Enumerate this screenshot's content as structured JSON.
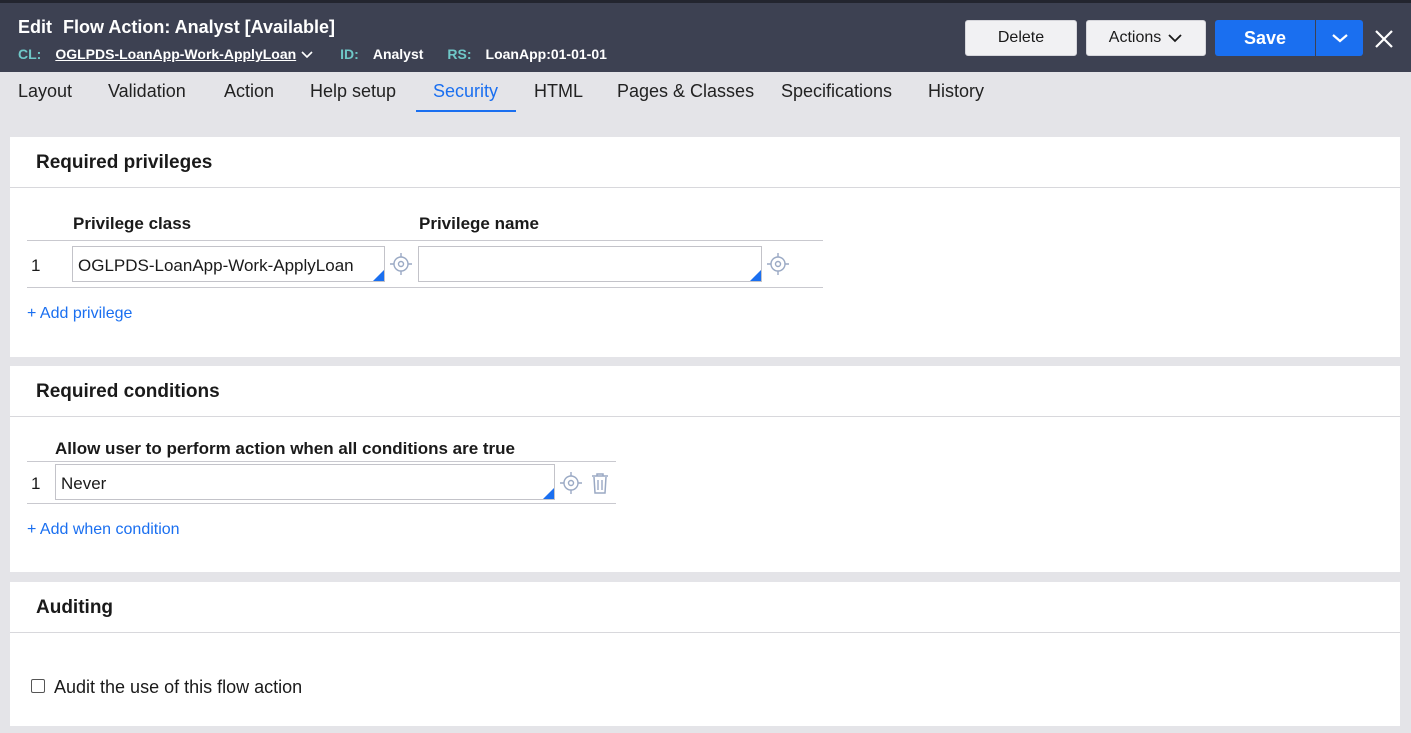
{
  "header": {
    "edit_label": "Edit",
    "title": "Flow Action: Analyst [Available]",
    "cl_key": "CL:",
    "cl_value": "OGLPDS-LoanApp-Work-ApplyLoan",
    "id_key": "ID:",
    "id_value": "Analyst",
    "rs_key": "RS:",
    "rs_value": "LoanApp:01-01-01",
    "delete_label": "Delete",
    "actions_label": "Actions",
    "save_label": "Save"
  },
  "tabs": [
    {
      "label": "Layout"
    },
    {
      "label": "Validation"
    },
    {
      "label": "Action"
    },
    {
      "label": "Help setup"
    },
    {
      "label": "Security"
    },
    {
      "label": "HTML"
    },
    {
      "label": "Pages & Classes"
    },
    {
      "label": "Specifications"
    },
    {
      "label": "History"
    }
  ],
  "active_tab": "Security",
  "privileges": {
    "title": "Required privileges",
    "col_class": "Privilege class",
    "col_name": "Privilege name",
    "rows": [
      {
        "num": "1",
        "class": "OGLPDS-LoanApp-Work-ApplyLoan",
        "name": ""
      }
    ],
    "add_label": "+ Add privilege"
  },
  "conditions": {
    "title": "Required conditions",
    "col_head": "Allow user to perform action when all conditions are true",
    "rows": [
      {
        "num": "1",
        "value": "Never"
      }
    ],
    "add_label": "+ Add when condition"
  },
  "auditing": {
    "title": "Auditing",
    "checkbox_label": "Audit the use of this flow action",
    "checked": false
  },
  "colors": {
    "header_bg": "#3d4152",
    "accent": "#1a6ff0",
    "meta_key": "#6fc8c8"
  }
}
